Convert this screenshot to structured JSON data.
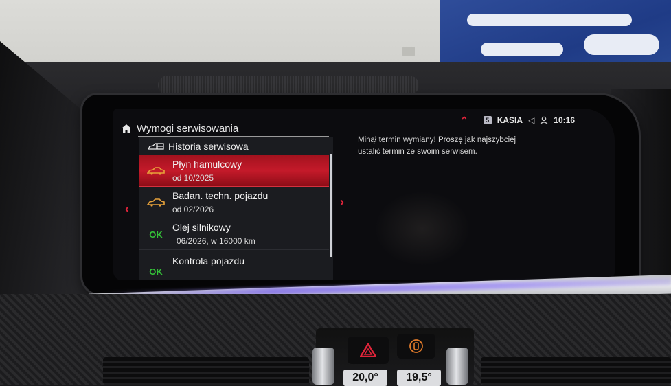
{
  "header": {
    "title": "Wymogi serwisowania",
    "home_icon": "home-icon"
  },
  "status_bar": {
    "profile_badge": "5",
    "user": "KASIA",
    "time": "10:16",
    "icons": [
      "up-chevron-icon",
      "speaker-muted-icon",
      "user-icon"
    ]
  },
  "submenu": {
    "label": "Historia serwisowa",
    "icon": "car-service-icon"
  },
  "service_items": [
    {
      "status_icon": "car-warning-icon",
      "status": "",
      "label": "Płyn hamulcowy",
      "date": "od 10/2025",
      "selected": true,
      "status_color": "#e8a23a"
    },
    {
      "status_icon": "car-warning-icon",
      "status": "",
      "label": "Badan. techn. pojazdu",
      "date": "od 02/2026",
      "selected": false,
      "status_color": "#e8a23a"
    },
    {
      "status_icon": "",
      "status": "OK",
      "label": "Olej silnikowy",
      "date": "06/2026, w 16000 km",
      "selected": false,
      "status_color": "#34c038"
    },
    {
      "status_icon": "",
      "status": "OK",
      "label": "Kontrola pojazdu",
      "date": "",
      "selected": false,
      "status_color": "#34c038"
    }
  ],
  "detail": {
    "message": "Minął termin wymiany! Proszę jak najszybciej ustalić termin ze swoim serwisem."
  },
  "climate": {
    "left_temp": "20,0°",
    "right_temp": "19,5°"
  },
  "colors": {
    "accent": "#e0243a",
    "selection": "#c41a2a",
    "warning": "#e8a23a",
    "ok": "#34c038"
  }
}
